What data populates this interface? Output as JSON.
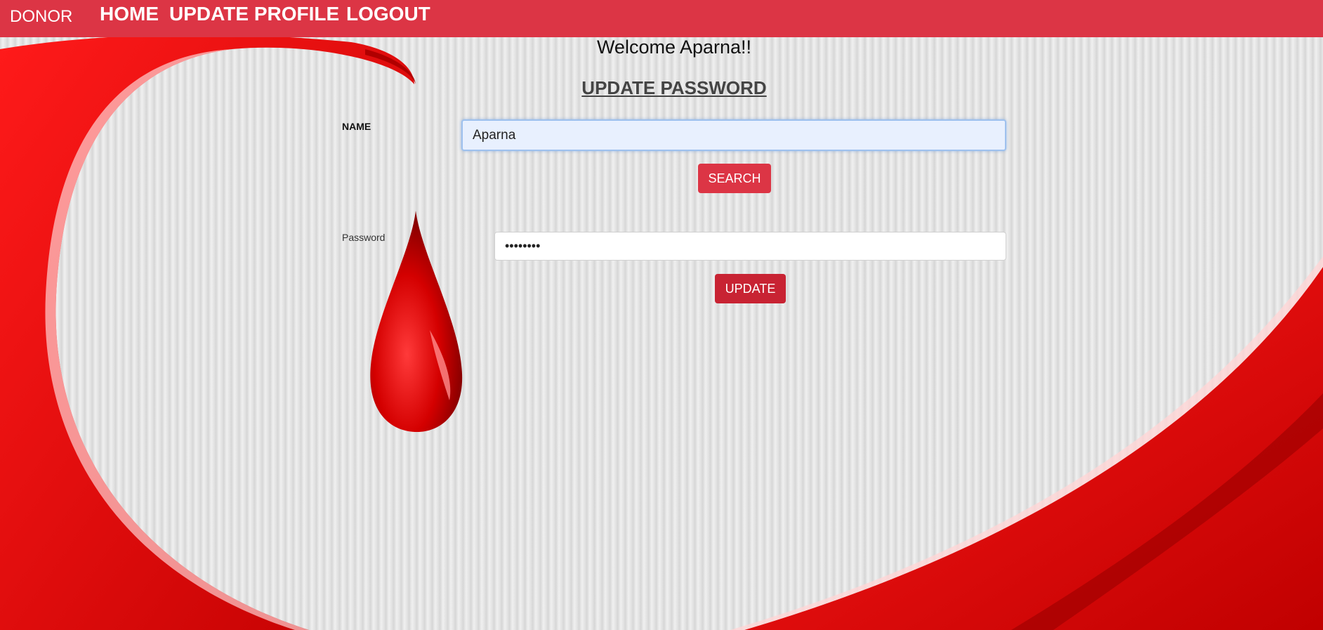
{
  "navbar": {
    "brand": "DONOR",
    "links": [
      "HOME",
      "UPDATE PROFILE",
      "LOGOUT"
    ]
  },
  "welcome": "Welcome Aparna!!",
  "title": "UPDATE PASSWORD",
  "form": {
    "name_label": "NAME",
    "name_value": "Aparna",
    "search_label": "SEARCH",
    "password_label": "Password",
    "password_value": "••••••••",
    "update_label": "UPDATE"
  },
  "colors": {
    "navbar": "#dc3545",
    "search_button": "#dc3545",
    "update_button": "#c82333",
    "background_art": "#e00000"
  },
  "decoration": {
    "background_icons": [
      "red-swirl-art",
      "blood-drop-icon"
    ]
  }
}
